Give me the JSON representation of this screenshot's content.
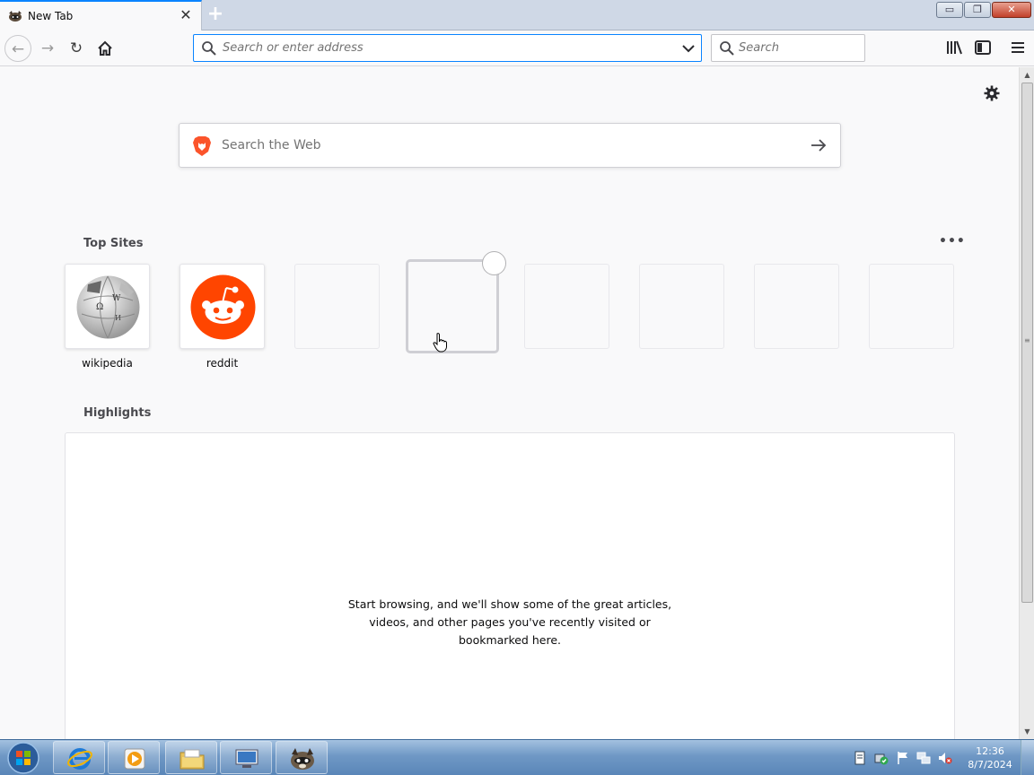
{
  "tab": {
    "title": "New Tab",
    "close_glyph": "✕",
    "favicon": "raccoon-icon"
  },
  "newtab_glyph": "+",
  "window_controls": {
    "minimize": "▭",
    "maximize": "❐",
    "close": "✕"
  },
  "nav": {
    "back": "←",
    "forward": "→",
    "reload": "↻",
    "home": "home-icon"
  },
  "urlbar": {
    "placeholder": "Search or enter address"
  },
  "searchbar": {
    "placeholder": "Search"
  },
  "websearch": {
    "placeholder": "Search the Web"
  },
  "top_sites": {
    "title": "Top Sites",
    "more": "•••",
    "tiles": [
      {
        "label": "wikipedia",
        "icon": "wikipedia-globe-icon"
      },
      {
        "label": "reddit",
        "icon": "reddit-icon"
      }
    ]
  },
  "highlights": {
    "title": "Highlights",
    "message_lines": [
      "Start browsing, and we'll show some of the great articles,",
      "videos, and other pages you've recently visited or",
      "bookmarked here."
    ]
  },
  "scrollbar": {
    "up": "▲",
    "down": "▼",
    "grip": "≡"
  },
  "taskbar": {
    "items": [
      "internet-explorer-icon",
      "media-player-icon",
      "file-explorer-icon",
      "remote-desktop-icon",
      "firefox-raccoon-icon"
    ],
    "clock": {
      "time": "12:36",
      "date": "8/7/2024"
    }
  },
  "colors": {
    "accent": "#0a84ff",
    "reddit": "#ff4500",
    "brave": "#fb542b"
  }
}
